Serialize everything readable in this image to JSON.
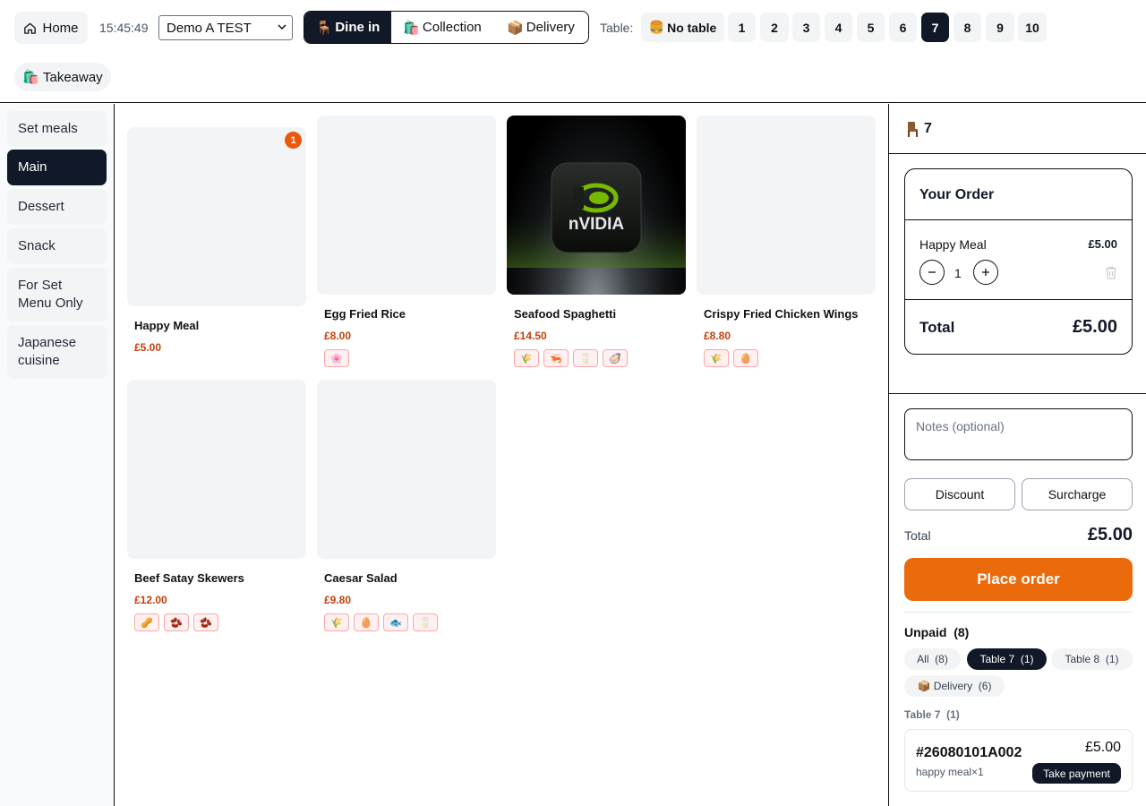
{
  "header": {
    "home_label": "Home",
    "clock": "15:45:49",
    "store_selected": "Demo A TEST",
    "order_modes": [
      {
        "icon": "🪑",
        "label": "Dine in",
        "active": true
      },
      {
        "icon": "🛍️",
        "label": "Collection",
        "active": false
      },
      {
        "icon": "📦",
        "label": "Delivery",
        "active": false
      }
    ],
    "table_label": "Table:",
    "no_table": {
      "icon": "🍔",
      "label": "No table"
    },
    "tables": [
      "1",
      "2",
      "3",
      "4",
      "5",
      "6",
      "7",
      "8",
      "9",
      "10"
    ],
    "active_table": "7",
    "takeaway": {
      "icon": "🛍️",
      "label": "Takeaway"
    }
  },
  "categories": [
    {
      "label": "Set meals",
      "active": false
    },
    {
      "label": "Main",
      "active": true
    },
    {
      "label": "Dessert",
      "active": false
    },
    {
      "label": "Snack",
      "active": false
    },
    {
      "label": "For Set Menu Only",
      "active": false
    },
    {
      "label": "Japanese cuisine",
      "active": false
    }
  ],
  "products": [
    {
      "name": "Happy Meal",
      "price": "£5.00",
      "badge": "1",
      "allergens": []
    },
    {
      "name": "Egg Fried Rice",
      "price": "£8.00",
      "allergens": [
        "🌸"
      ]
    },
    {
      "name": "Seafood Spaghetti",
      "price": "£14.50",
      "image_text": "nVIDIA",
      "allergens": [
        "🌾",
        "🦐",
        "🥛",
        "🦪"
      ]
    },
    {
      "name": "Crispy Fried Chicken Wings",
      "price": "£8.80",
      "allergens": [
        "🌾",
        "🥚"
      ]
    },
    {
      "name": "Beef Satay Skewers",
      "price": "£12.00",
      "allergens": [
        "🥜",
        "🫘",
        "🫘"
      ]
    },
    {
      "name": "Caesar Salad",
      "price": "£9.80",
      "allergens": [
        "🌾",
        "🥚",
        "🐟",
        "🥛"
      ]
    }
  ],
  "order_panel": {
    "table_number": "7",
    "your_order_title": "Your Order",
    "items": [
      {
        "name": "Happy Meal",
        "price": "£5.00",
        "qty": "1"
      }
    ],
    "order_total_label": "Total",
    "order_total_value": "£5.00",
    "notes_placeholder": "Notes (optional)",
    "discount_label": "Discount",
    "surcharge_label": "Surcharge",
    "total_label": "Total",
    "total_value": "£5.00",
    "place_order_label": "Place order",
    "unpaid_title": "Unpaid  (8)",
    "filters": [
      {
        "label": "All  (8)",
        "active": false
      },
      {
        "label": "Table 7  (1)",
        "active": true
      },
      {
        "label": "Table 8  (1)",
        "active": false
      },
      {
        "label": "📦 Delivery  (6)",
        "active": false
      }
    ],
    "group_label": "Table 7  (1)",
    "unpaid_orders": [
      {
        "id": "#26080101A002",
        "amount": "£5.00",
        "items": "happy meal×1",
        "pay_label": "Take payment"
      }
    ]
  },
  "colors": {
    "accent": "#ea6a0c",
    "dark": "#111827",
    "price": "#c2410c"
  }
}
